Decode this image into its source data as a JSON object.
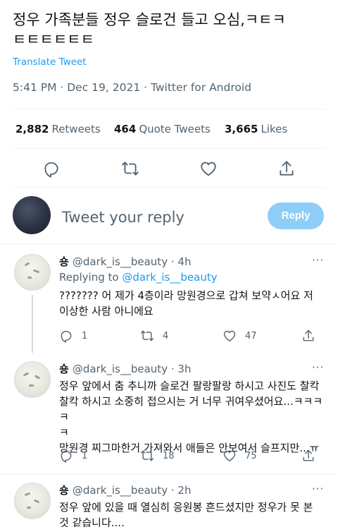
{
  "tweet": {
    "text_line1": "정우 가족분들 정우 슬로건 들고 오심,ㅋㅌㅋ",
    "text_line2": "ㅌㅌㅌㅌㅌㅌ",
    "translate_label": "Translate Tweet",
    "timestamp": "5:41 PM · Dec 19, 2021 · Twitter for Android"
  },
  "stats": {
    "retweets_count": "2,882",
    "retweets_label": "Retweets",
    "quotes_count": "464",
    "quotes_label": "Quote Tweets",
    "likes_count": "3,665",
    "likes_label": "Likes"
  },
  "actions": [
    "reply-icon",
    "retweet-icon",
    "like-icon",
    "share-icon"
  ],
  "compose": {
    "placeholder": "Tweet your reply",
    "reply_button": "Reply"
  },
  "colors": {
    "accent": "#1d9bf0",
    "reply_button_disabled": "#8ecdf8",
    "secondary_text": "#536471"
  },
  "replies": [
    {
      "name": "숑",
      "handle": "@dark_is__beauty",
      "time": "· 4h",
      "more": "···",
      "replying_prefix": "Replying to ",
      "replying_to": "@dark_is__beauty",
      "text_line1": "??????? 어 제가 4층이라 망원경으로 갑쳐 보약ㅅ어요 저",
      "text_line2": "이상한 사람 아니에요",
      "reply_count": "1",
      "retweet_count": "4",
      "like_count": "47"
    },
    {
      "name": "숑",
      "handle": "@dark_is__beauty",
      "time": "· 3h",
      "more": "···",
      "text_line1": "정우 앞에서 춤 추니까 슬로건 팔랑팔랑 하시고 사진도 찰칵",
      "text_line2": "찰칵 하시고 소중히 접으시는 거 너무 귀여우셨어요...ㅋㅋㅋㅋ",
      "text_line3": "ㅋ",
      "text_line4": "망원경 찌그마한거 가져와서 애들은 안보여서 슬프지만...ㅠ",
      "reply_count": "1",
      "retweet_count": "18",
      "like_count": "75"
    },
    {
      "name": "숑",
      "handle": "@dark_is__beauty",
      "time": "· 2h",
      "more": "···",
      "text_line1": "정우 앞에 있을 때 열심히 응원봉 흔드셨지만 정우가 못 본",
      "text_line2": "것 같습니다...."
    }
  ]
}
